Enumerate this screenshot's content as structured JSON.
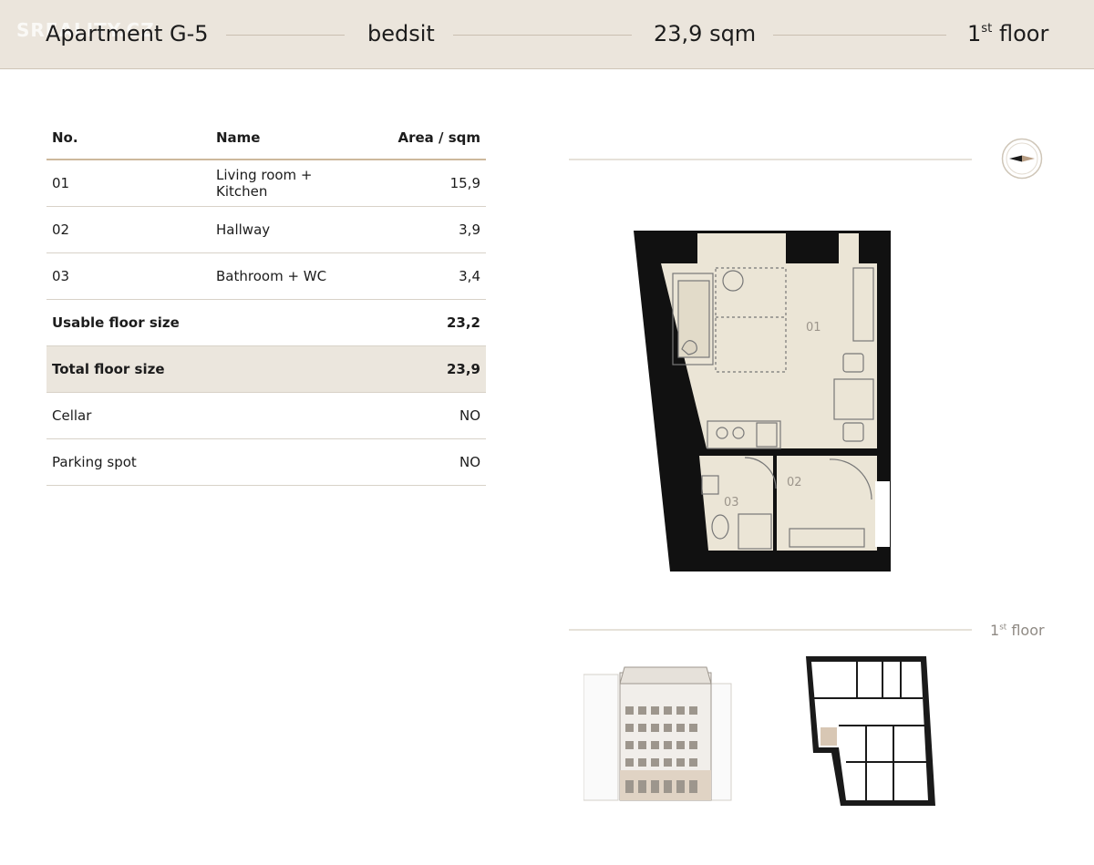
{
  "header": {
    "watermark": "SREALITY.CZ",
    "apartment": "Apartment G-5",
    "type": "bedsit",
    "area": "23,9 sqm",
    "floor_num": "1",
    "floor_sup": "st",
    "floor_word": "floor"
  },
  "table": {
    "headers": {
      "no": "No.",
      "name": "Name",
      "area": "Area / sqm"
    },
    "rooms": [
      {
        "no": "01",
        "name": "Living room + Kitchen",
        "area": "15,9"
      },
      {
        "no": "02",
        "name": "Hallway",
        "area": "3,9"
      },
      {
        "no": "03",
        "name": "Bathroom + WC",
        "area": "3,4"
      }
    ],
    "usable": {
      "label": "Usable floor size",
      "value": "23,2"
    },
    "total": {
      "label": "Total floor size",
      "value": "23,9"
    },
    "cellar": {
      "label": "Cellar",
      "value": "NO"
    },
    "parking": {
      "label": "Parking spot",
      "value": "NO"
    }
  },
  "plan": {
    "room_01": "01",
    "room_02": "02",
    "room_03": "03"
  },
  "floor_label": {
    "num": "1",
    "sup": "st",
    "word": "floor"
  },
  "icons": {
    "compass": "compass-icon"
  },
  "colors": {
    "header_bg": "#ebe5dc",
    "plan_fill": "#ebe5d6",
    "wall": "#111111",
    "accent_line": "#cdb89c"
  }
}
